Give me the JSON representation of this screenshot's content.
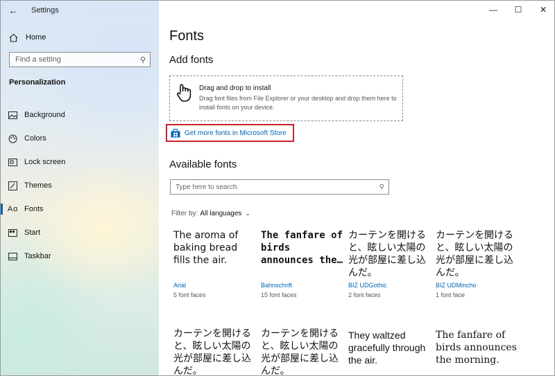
{
  "window": {
    "title": "Settings"
  },
  "sidebar": {
    "home_label": "Home",
    "search_placeholder": "Find a setting",
    "section_title": "Personalization",
    "items": [
      {
        "label": "Background",
        "icon": "image-icon"
      },
      {
        "label": "Colors",
        "icon": "palette-icon"
      },
      {
        "label": "Lock screen",
        "icon": "lock-screen-icon"
      },
      {
        "label": "Themes",
        "icon": "brush-icon"
      },
      {
        "label": "Fonts",
        "icon": "font-icon",
        "active": true
      },
      {
        "label": "Start",
        "icon": "start-icon"
      },
      {
        "label": "Taskbar",
        "icon": "taskbar-icon"
      }
    ]
  },
  "main": {
    "page_title": "Fonts",
    "add_fonts_heading": "Add fonts",
    "drop_title": "Drag and drop to install",
    "drop_desc": "Drag font files from File Explorer or your desktop and drop them here to install fonts on your device.",
    "store_link": "Get more fonts in Microsoft Store",
    "available_heading": "Available fonts",
    "search_placeholder": "Type here to search.",
    "filter_label": "Filter by:",
    "filter_value": "All languages",
    "fonts": [
      {
        "sample": "The aroma of baking bread fills the air.",
        "name": "Arial",
        "faces": "5 font faces"
      },
      {
        "sample": "The fanfare of birds announces the…",
        "name": "Bahnschrift",
        "faces": "15 font faces"
      },
      {
        "sample": "カーテンを開けると、眩しい太陽の光が部屋に差し込んだ。",
        "name": "BIZ UDGothic",
        "faces": "2 font faces"
      },
      {
        "sample": "カーテンを開けると、眩しい太陽の光が部屋に差し込んだ。",
        "name": "BIZ UDMincho",
        "faces": "1 font face"
      },
      {
        "sample": "カーテンを開けると、眩しい太陽の光が部屋に差し込んだ。",
        "name": "",
        "faces": ""
      },
      {
        "sample": "カーテンを開けると、眩しい太陽の光が部屋に差し込んだ。",
        "name": "",
        "faces": ""
      },
      {
        "sample": "They waltzed gracefully through the air.",
        "name": "",
        "faces": ""
      },
      {
        "sample": "The fanfare of birds announces the morning.",
        "name": "",
        "faces": ""
      }
    ]
  },
  "colors": {
    "accent": "#0063b1",
    "highlight_border": "#c8202a"
  }
}
